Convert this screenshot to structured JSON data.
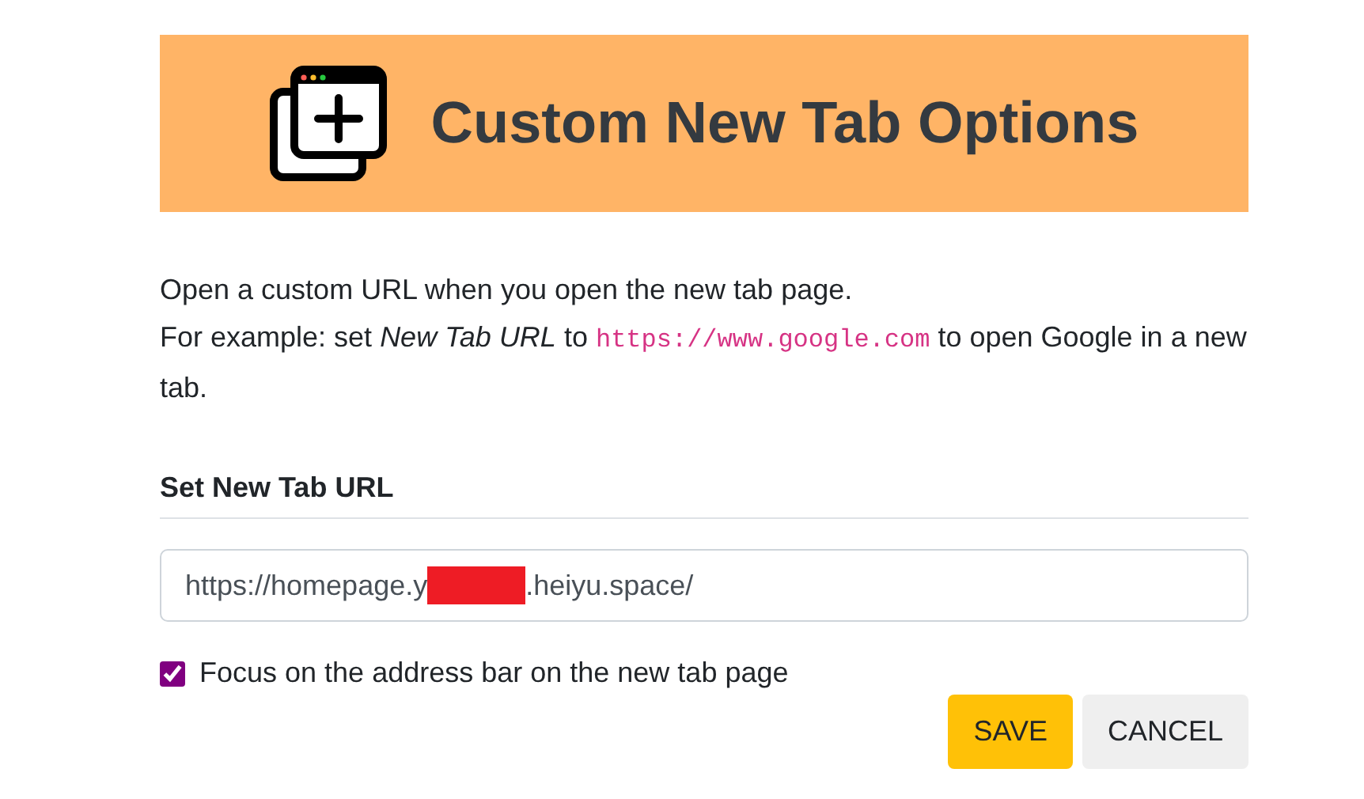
{
  "header": {
    "title": "Custom New Tab Options"
  },
  "intro": {
    "line_1": "Open a custom URL when you open the new tab page.",
    "line_2": [
      {
        "kind": "text",
        "text": "For example: set "
      },
      {
        "kind": "emphasis",
        "text": "New Tab URL"
      },
      {
        "kind": "text",
        "text": " to "
      },
      {
        "kind": "code",
        "text": "https://www.google.com"
      },
      {
        "kind": "text",
        "text": " to open Google in a new tab."
      }
    ]
  },
  "section": {
    "heading": "Set New Tab URL"
  },
  "url_field": {
    "value_before": "https://homepage.y",
    "redacted": true,
    "value_after": ".heiyu.space/"
  },
  "focus_option": {
    "label": "Focus on the address bar on the new tab page",
    "checked": true
  },
  "buttons": [
    {
      "kind": "primary",
      "label": "SAVE"
    },
    {
      "kind": "secondary",
      "label": "CANCEL"
    }
  ]
}
